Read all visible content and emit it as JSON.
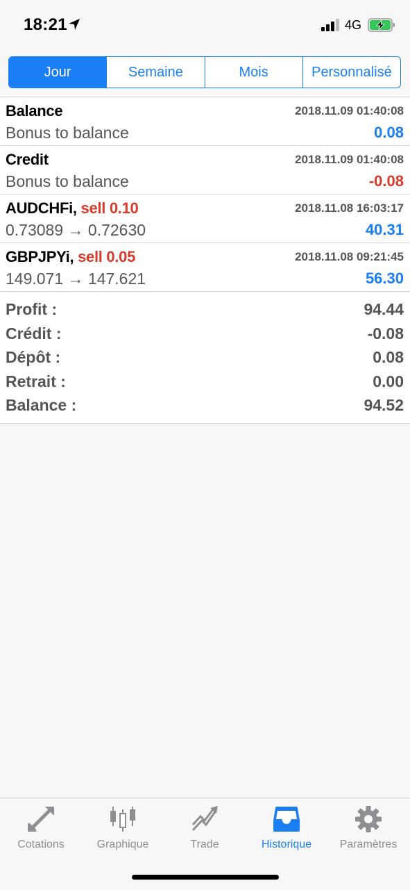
{
  "status_bar": {
    "time": "18:21",
    "network": "4G"
  },
  "segments": [
    {
      "label": "Jour",
      "active": true
    },
    {
      "label": "Semaine",
      "active": false
    },
    {
      "label": "Mois",
      "active": false
    },
    {
      "label": "Personnalisé",
      "active": false
    }
  ],
  "history": [
    {
      "title": "Balance",
      "sell": "",
      "time": "2018.11.09 01:40:08",
      "sub": "Bonus to balance",
      "amount": "0.08",
      "sign": "pos"
    },
    {
      "title": "Credit",
      "sell": "",
      "time": "2018.11.09 01:40:08",
      "sub": "Bonus to balance",
      "amount": "-0.08",
      "sign": "neg"
    },
    {
      "title": "AUDCHFi,",
      "sell": "sell 0.10",
      "time": "2018.11.08 16:03:17",
      "sub": "0.73089 → 0.72630",
      "amount": "40.31",
      "sign": "pos"
    },
    {
      "title": "GBPJPYi,",
      "sell": "sell 0.05",
      "time": "2018.11.08 09:21:45",
      "sub": "149.071 → 147.621",
      "amount": "56.30",
      "sign": "pos"
    }
  ],
  "summary": [
    {
      "label": "Profit :",
      "value": "94.44"
    },
    {
      "label": "Crédit :",
      "value": "-0.08"
    },
    {
      "label": "Dépôt :",
      "value": "0.08"
    },
    {
      "label": "Retrait :",
      "value": "0.00"
    },
    {
      "label": "Balance :",
      "value": "94.52"
    }
  ],
  "tabs": [
    {
      "label": "Cotations",
      "icon": "quotes-arrows-icon",
      "active": false
    },
    {
      "label": "Graphique",
      "icon": "candlestick-chart-icon",
      "active": false
    },
    {
      "label": "Trade",
      "icon": "trade-trend-icon",
      "active": false
    },
    {
      "label": "Historique",
      "icon": "inbox-tray-icon",
      "active": true
    },
    {
      "label": "Paramètres",
      "icon": "gear-icon",
      "active": false
    }
  ],
  "colors": {
    "accent": "#1a7ff5",
    "negative": "#d93a2a",
    "inactive_tab": "#8e8e93"
  }
}
